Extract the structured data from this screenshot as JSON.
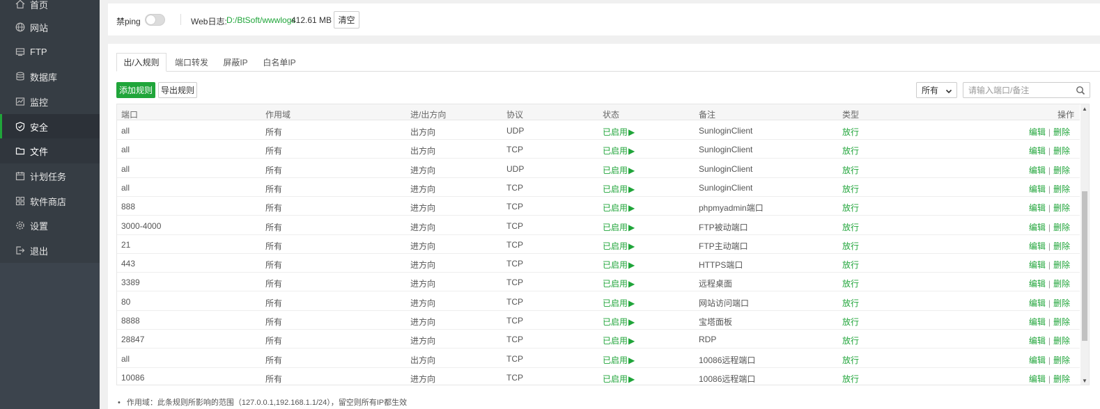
{
  "sidebar": {
    "items": [
      {
        "label": "首页",
        "icon": "home-icon"
      },
      {
        "label": "网站",
        "icon": "globe-icon"
      },
      {
        "label": "FTP",
        "icon": "ftp-icon"
      },
      {
        "label": "数据库",
        "icon": "database-icon"
      },
      {
        "label": "监控",
        "icon": "monitor-icon"
      },
      {
        "label": "安全",
        "icon": "shield-icon"
      },
      {
        "label": "文件",
        "icon": "folder-icon"
      },
      {
        "label": "计划任务",
        "icon": "calendar-icon"
      },
      {
        "label": "软件商店",
        "icon": "grid-icon"
      },
      {
        "label": "设置",
        "icon": "gear-icon"
      },
      {
        "label": "退出",
        "icon": "logout-icon"
      }
    ],
    "active_index": 5
  },
  "topbar": {
    "ping_label": "禁ping",
    "ping_enabled": false,
    "weblog_label": "Web日志:",
    "weblog_path": "D:/BtSoft/wwwlogs",
    "weblog_size": "412.61 MB",
    "clear_button": "清空"
  },
  "tabs": [
    {
      "label": "出/入规则",
      "active": true
    },
    {
      "label": "端口转发",
      "active": false
    },
    {
      "label": "屏蔽IP",
      "active": false
    },
    {
      "label": "白名单IP",
      "active": false
    }
  ],
  "toolbar": {
    "add_button": "添加规则",
    "export_button": "导出规则",
    "filter_selected": "所有",
    "search_placeholder": "请输入端口/备注"
  },
  "table": {
    "headers": [
      "端口",
      "作用域",
      "进/出方向",
      "协议",
      "状态",
      "备注",
      "类型",
      "操作"
    ],
    "edit_label": "编辑",
    "delete_label": "删除",
    "separator": "|",
    "rows": [
      {
        "port": "all",
        "scope": "所有",
        "direction": "出方向",
        "protocol": "UDP",
        "status": "已启用",
        "remark": "SunloginClient",
        "type": "放行"
      },
      {
        "port": "all",
        "scope": "所有",
        "direction": "出方向",
        "protocol": "TCP",
        "status": "已启用",
        "remark": "SunloginClient",
        "type": "放行"
      },
      {
        "port": "all",
        "scope": "所有",
        "direction": "进方向",
        "protocol": "UDP",
        "status": "已启用",
        "remark": "SunloginClient",
        "type": "放行"
      },
      {
        "port": "all",
        "scope": "所有",
        "direction": "进方向",
        "protocol": "TCP",
        "status": "已启用",
        "remark": "SunloginClient",
        "type": "放行"
      },
      {
        "port": "888",
        "scope": "所有",
        "direction": "进方向",
        "protocol": "TCP",
        "status": "已启用",
        "remark": "phpmyadmin端口",
        "type": "放行"
      },
      {
        "port": "3000-4000",
        "scope": "所有",
        "direction": "进方向",
        "protocol": "TCP",
        "status": "已启用",
        "remark": "FTP被动端口",
        "type": "放行"
      },
      {
        "port": "21",
        "scope": "所有",
        "direction": "进方向",
        "protocol": "TCP",
        "status": "已启用",
        "remark": "FTP主动端口",
        "type": "放行"
      },
      {
        "port": "443",
        "scope": "所有",
        "direction": "进方向",
        "protocol": "TCP",
        "status": "已启用",
        "remark": "HTTPS端口",
        "type": "放行"
      },
      {
        "port": "3389",
        "scope": "所有",
        "direction": "进方向",
        "protocol": "TCP",
        "status": "已启用",
        "remark": "远程桌面",
        "type": "放行"
      },
      {
        "port": "80",
        "scope": "所有",
        "direction": "进方向",
        "protocol": "TCP",
        "status": "已启用",
        "remark": "网站访问端口",
        "type": "放行"
      },
      {
        "port": "8888",
        "scope": "所有",
        "direction": "进方向",
        "protocol": "TCP",
        "status": "已启用",
        "remark": "宝塔面板",
        "type": "放行"
      },
      {
        "port": "28847",
        "scope": "所有",
        "direction": "进方向",
        "protocol": "TCP",
        "status": "已启用",
        "remark": "RDP",
        "type": "放行"
      },
      {
        "port": "all",
        "scope": "所有",
        "direction": "出方向",
        "protocol": "TCP",
        "status": "已启用",
        "remark": "10086远程端口",
        "type": "放行"
      },
      {
        "port": "10086",
        "scope": "所有",
        "direction": "进方向",
        "protocol": "TCP",
        "status": "已启用",
        "remark": "10086远程端口",
        "type": "放行"
      }
    ]
  },
  "footnote": "作用域：此条规则所影响的范围（127.0.0.1,192.168.1.1/24），留空则所有IP都生效",
  "colors": {
    "accent": "#20a53a",
    "sidebar_bg": "#3c444d"
  }
}
